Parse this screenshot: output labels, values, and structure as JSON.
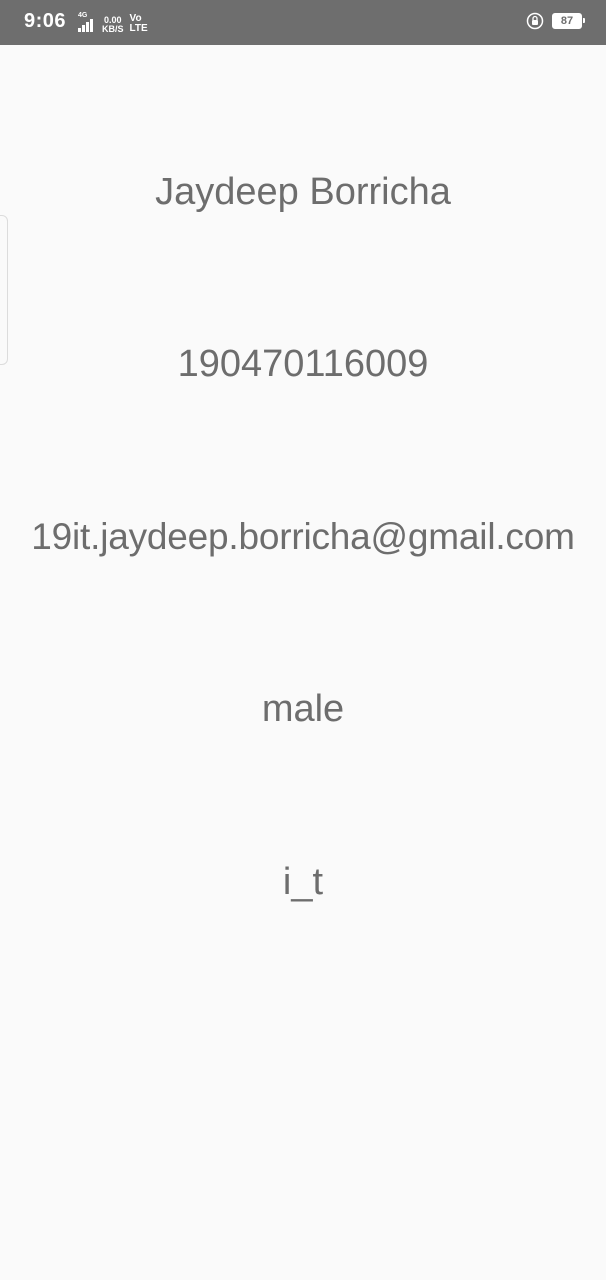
{
  "status_bar": {
    "time": "9:06",
    "network_type": "4G",
    "speed_value": "0.00",
    "speed_unit": "KB/S",
    "volte_top": "Vo",
    "volte_bottom": "LTE",
    "battery_level": "87",
    "icons": [
      "signal-icon",
      "rotation-lock-icon",
      "battery-icon"
    ]
  },
  "profile": {
    "name": "Jaydeep Borricha",
    "enrollment": "190470116009",
    "email": "19it.jaydeep.borricha@gmail.com",
    "gender": "male",
    "branch": "i_t"
  },
  "colors": {
    "status_bar_bg": "#6e6e6e",
    "page_bg": "#fafafa",
    "text": "#6d6d6d"
  }
}
